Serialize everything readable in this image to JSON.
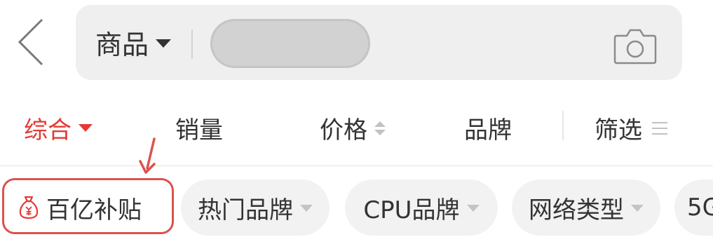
{
  "header": {
    "back_icon": "chevron-left-icon",
    "search": {
      "scope_label": "商品",
      "camera_icon": "camera-icon"
    }
  },
  "sort_bar": {
    "items": [
      {
        "label": "综合",
        "active": true,
        "icon": "caret-down-icon"
      },
      {
        "label": "销量",
        "active": false
      },
      {
        "label": "价格",
        "active": false,
        "icon": "sort-updown-icon"
      },
      {
        "label": "品牌",
        "active": false
      },
      {
        "label": "筛选",
        "active": false,
        "icon": "menu-icon"
      }
    ]
  },
  "filter_chips": [
    {
      "label": "百亿补贴",
      "icon": "money-bag-icon",
      "highlighted": true
    },
    {
      "label": "热门品牌",
      "icon": "caret-down-icon"
    },
    {
      "label": "CPU品牌",
      "icon": "caret-down-icon"
    },
    {
      "label": "网络类型",
      "icon": "caret-down-icon"
    },
    {
      "label": "5G"
    }
  ],
  "colors": {
    "accent": "#e53935",
    "annotation": "#d9534f",
    "search_bg": "#efefef",
    "chip_bg": "#f2f2f2"
  }
}
